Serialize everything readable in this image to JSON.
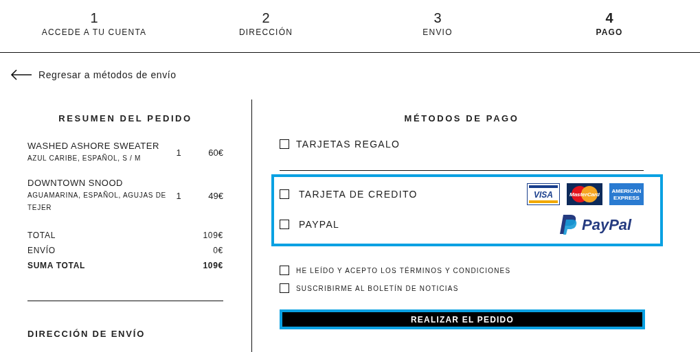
{
  "steps": [
    {
      "number": "1",
      "label": "ACCEDE A TU CUENTA",
      "selected": false
    },
    {
      "number": "2",
      "label": "DIRECCIÓN",
      "selected": false
    },
    {
      "number": "3",
      "label": "ENVIO",
      "selected": false
    },
    {
      "number": "4",
      "label": "PAGO",
      "selected": true
    }
  ],
  "back_link": "Regresar a métodos de envío",
  "summary": {
    "title": "RESUMEN DEL PEDIDO",
    "items": [
      {
        "name": "WASHED ASHORE SWEATER",
        "details": "AZUL CARIBE, ESPAÑOL, S / M",
        "quantity": "1",
        "price": "60€"
      },
      {
        "name": "DOWNTOWN SNOOD",
        "details": "AGUAMARINA, ESPAÑOL, AGUJAS DE TEJER",
        "quantity": "1",
        "price": "49€"
      }
    ],
    "totals": [
      {
        "label": "TOTAL",
        "value": "109€",
        "bold": false
      },
      {
        "label": "ENVÍO",
        "value": "0€",
        "bold": false
      },
      {
        "label": "SUMA TOTAL",
        "value": "109€",
        "bold": true
      }
    ],
    "shipping_title": "DIRECCIÓN DE ENVÍO"
  },
  "payment": {
    "title": "MÉTODOS DE PAGO",
    "gift_card": {
      "label": "TARJETAS REGALO",
      "checked": false
    },
    "methods": [
      {
        "label": "TARJETA DE CREDITO",
        "checked": false,
        "kind": "cards",
        "logos": [
          "VISA",
          "MasterCard",
          "AMERICAN EXPRESS"
        ]
      },
      {
        "label": "PAYPAL",
        "checked": false,
        "kind": "paypal",
        "logos": [
          "PayPal"
        ]
      }
    ],
    "agreements": [
      {
        "label": "HE LEÍDO Y ACEPTO LOS TÉRMINOS Y CONDICIONES",
        "checked": false
      },
      {
        "label": "SUSCRIBIRME AL BOLETÍN DE NOTICIAS",
        "checked": false
      }
    ],
    "submit": "REALIZAR EL PEDIDO"
  }
}
